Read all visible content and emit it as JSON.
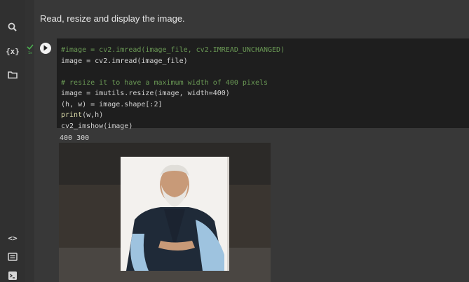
{
  "sidebar": {
    "items": [
      {
        "name": "search-icon"
      },
      {
        "name": "variables-icon",
        "label": "{x}"
      },
      {
        "name": "folder-icon"
      },
      {
        "name": "code-snippets-icon",
        "label": "<>"
      },
      {
        "name": "command-palette-icon"
      },
      {
        "name": "terminal-icon"
      }
    ]
  },
  "markdown_cell": {
    "text": "Read, resize and display the image."
  },
  "code_cell": {
    "lines": [
      "#image = cv2.imread(image_file, cv2.IMREAD_UNCHANGED)",
      "image = cv2.imread(image_file)",
      "",
      "# resize it to have a maximum width of 400 pixels",
      "image = imutils.resize(image, width=400)",
      "(h, w) = image.shape[:2]",
      "print(w,h)",
      "cv2_imshow(image)"
    ],
    "status": "success",
    "run_icon": "play-icon"
  },
  "output": {
    "text": "400 300",
    "image_icon": "portrait-photo"
  },
  "colors": {
    "comment": "#6a9955",
    "builtin": "#dcdcaa",
    "status_ok": "#4caf50"
  }
}
